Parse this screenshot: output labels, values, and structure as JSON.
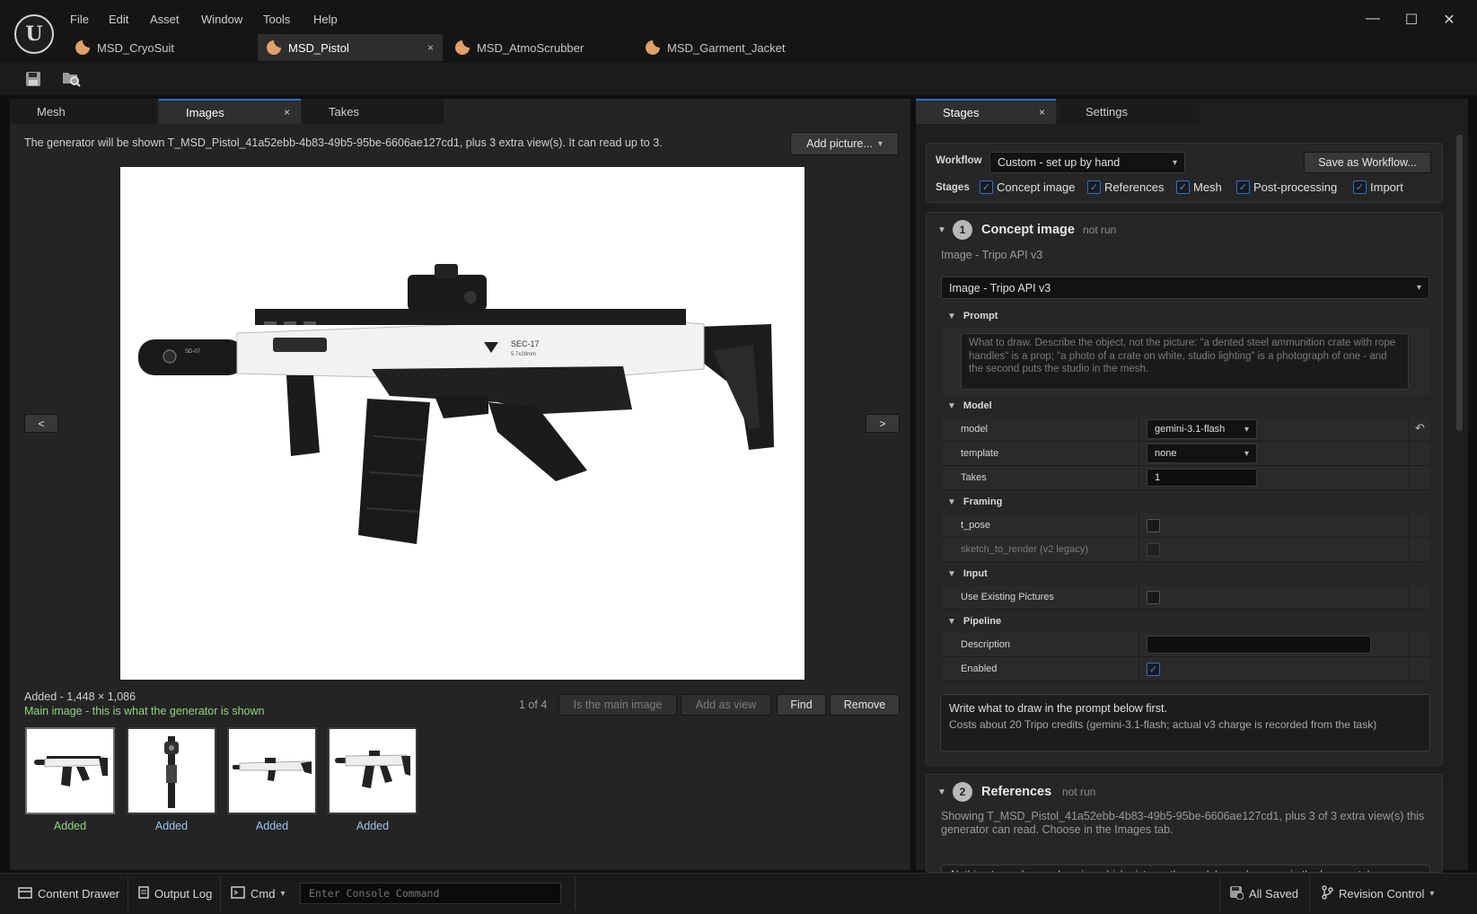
{
  "menu": [
    "File",
    "Edit",
    "Asset",
    "Window",
    "Tools",
    "Help"
  ],
  "doc_tabs": [
    {
      "label": "MSD_CryoSuit",
      "active": false
    },
    {
      "label": "MSD_Pistol",
      "active": true,
      "close": "×"
    },
    {
      "label": "MSD_AtmoScrubber",
      "active": false
    },
    {
      "label": "MSD_Garment_Jacket",
      "active": false
    }
  ],
  "window_controls": {
    "minimize": "—",
    "maximize": "☐",
    "close": "✕"
  },
  "logo": "U",
  "left_tabs": [
    {
      "label": "Mesh"
    },
    {
      "label": "Images",
      "close": "×"
    },
    {
      "label": "Takes"
    }
  ],
  "images": {
    "info": "The generator will be shown T_MSD_Pistol_41a52ebb-4b83-49b5-95be-6606ae127cd1, plus 3 extra view(s). It can read up to 3.",
    "add_picture": "Add picture...",
    "prev": "<",
    "next": ">",
    "added_line": "Added  -  1,448 × 1,086",
    "main_note": "Main image - this is what the generator is shown",
    "page": "1 of 4",
    "btn_is_main": "Is the main image",
    "btn_add_view": "Add as view",
    "btn_find": "Find",
    "btn_remove": "Remove",
    "gun_text_model": "SEC-17",
    "gun_text_cal": "5.7x28mm",
    "suppressor_text": "SD-07",
    "thumbs": [
      {
        "caption": "Added",
        "color": "#8ed47d"
      },
      {
        "caption": "Added",
        "color": "#9ec3ea"
      },
      {
        "caption": "Added",
        "color": "#9ec3ea"
      },
      {
        "caption": "Added",
        "color": "#9ec3ea"
      }
    ]
  },
  "right_tabs": [
    {
      "label": "Stages",
      "close": "×"
    },
    {
      "label": "Settings"
    }
  ],
  "workflow": {
    "label": "Workflow",
    "value": "Custom - set up by hand",
    "save_btn": "Save as Workflow...",
    "stages_label": "Stages",
    "stages": [
      {
        "label": "Concept image",
        "checked": true
      },
      {
        "label": "References",
        "checked": true
      },
      {
        "label": "Mesh",
        "checked": true
      },
      {
        "label": "Post-processing",
        "checked": true
      },
      {
        "label": "Import",
        "checked": true
      }
    ]
  },
  "stage1": {
    "num": "1",
    "title": "Concept image",
    "status": "not run",
    "subtitle": "Image - Tripo API v3",
    "provider": "Image - Tripo API v3",
    "cat_prompt": "Prompt",
    "prompt_placeholder": "What to draw. Describe the object, not the picture: \"a dented steel ammunition crate with rope handles\" is a prop; \"a photo of a crate on white, studio lighting\" is a photograph of one - and the second puts the studio in the mesh.",
    "cat_model": "Model",
    "model_label": "model",
    "model_value": "gemini-3.1-flash",
    "template_label": "template",
    "template_value": "none",
    "takes_label": "Takes",
    "takes_value": "1",
    "cat_framing": "Framing",
    "t_pose_label": "t_pose",
    "sketch_label": "sketch_to_render (v2 legacy)",
    "cat_input": "Input",
    "use_existing_label": "Use Existing Pictures",
    "cat_pipeline": "Pipeline",
    "description_label": "Description",
    "enabled_label": "Enabled",
    "note_title": "Write what to draw in the prompt below first.",
    "note_body": "Costs about 20 Tripo credits (gemini-3.1-flash; actual v3 charge is recorded from the task)"
  },
  "stage2": {
    "num": "2",
    "title": "References",
    "status": "not run",
    "text": "Showing T_MSD_Pistol_41a52ebb-4b83-49b5-95be-6606ae127cd1, plus 3 of 3 extra view(s) this generator can read. Choose in the Images tab.",
    "cut_text": "Nothing to run here - choosing which pictures the model sees happens in the Images tab"
  },
  "status_bar": {
    "content_drawer": "Content Drawer",
    "output_log": "Output Log",
    "cmd": "Cmd",
    "console_placeholder": "Enter Console Command",
    "all_saved": "All Saved",
    "revision_control": "Revision Control"
  }
}
